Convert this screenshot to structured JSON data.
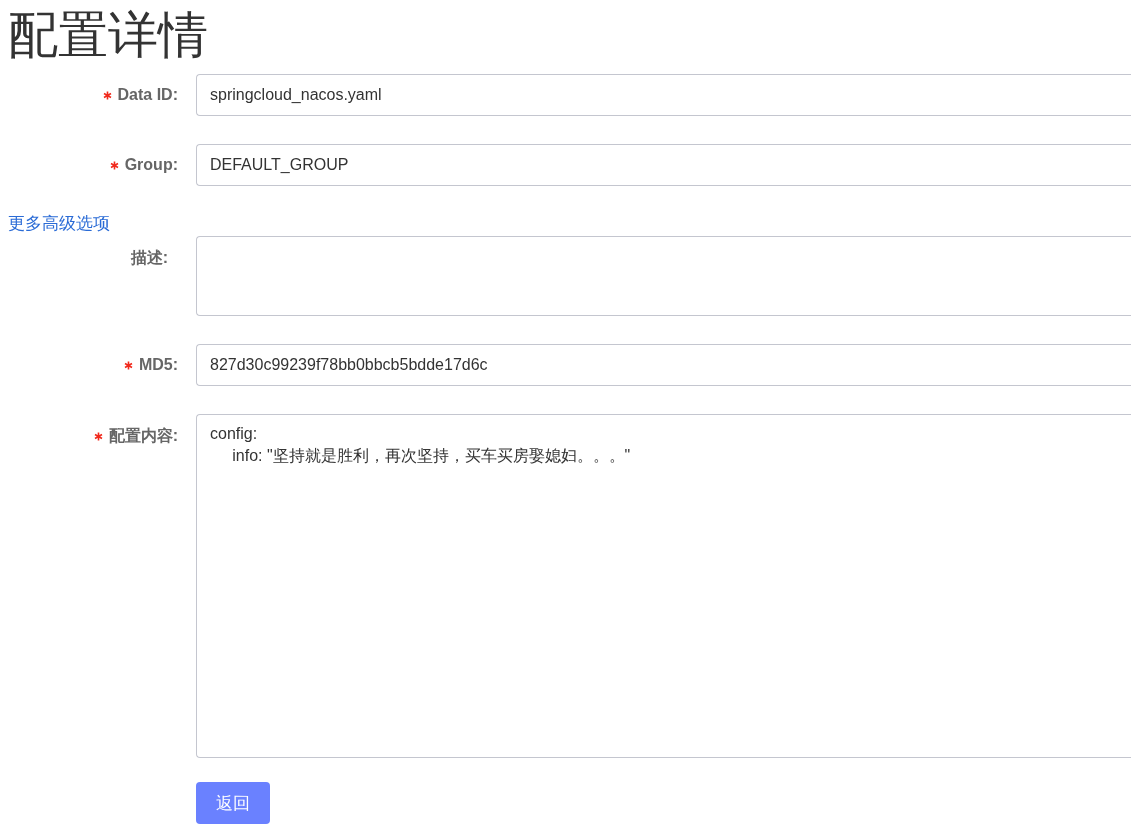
{
  "page_title": "配置详情",
  "fields": [
    {
      "kind": "input",
      "label": "Data ID:",
      "required": true,
      "value": "springcloud_nacos.yaml"
    },
    {
      "kind": "input",
      "label": "Group:",
      "required": true,
      "value": "DEFAULT_GROUP"
    },
    {
      "kind": "link",
      "text": "更多高级选项"
    },
    {
      "kind": "textarea",
      "label": "描述:",
      "required": false
    },
    {
      "kind": "input",
      "label": "MD5:",
      "required": true,
      "value": "827d30c99239f78bb0bbcb5bdde17d6c"
    },
    {
      "kind": "editor",
      "label": "配置内容:",
      "required": true,
      "value": "config:\n     info: \"坚持就是胜利，再次坚持，买车买房娶媳妇。。。\""
    }
  ],
  "buttons": [
    {
      "label": "返回"
    }
  ]
}
